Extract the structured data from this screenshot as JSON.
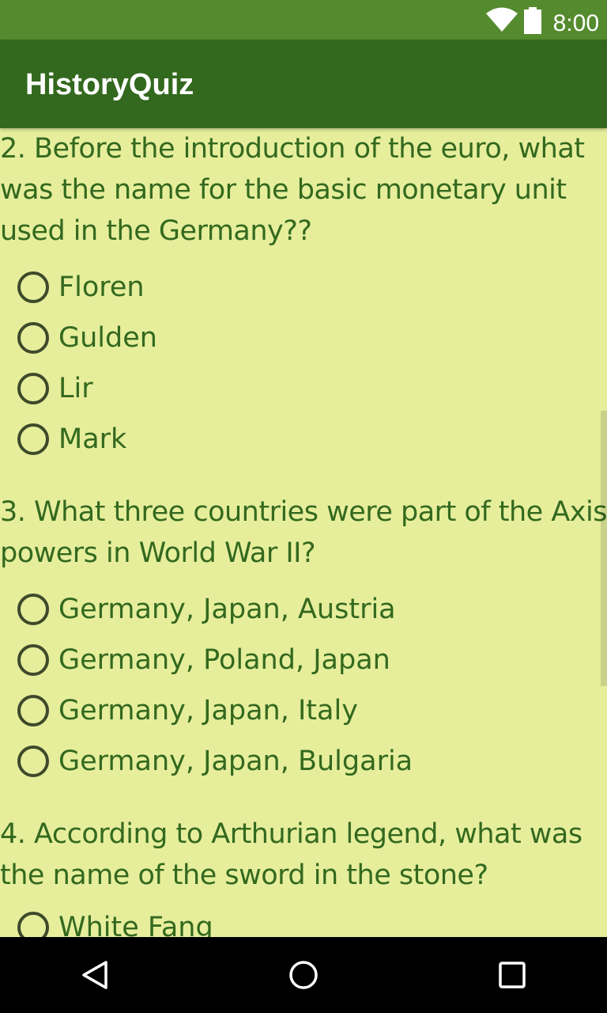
{
  "status_bar": {
    "time": "8:00",
    "icons": [
      "wifi-icon",
      "battery-icon"
    ]
  },
  "app_bar": {
    "title": "HistoryQuiz"
  },
  "questions": [
    {
      "text": "2. Before the introduction of the euro, what was the name for the basic monetary unit used in the Germany??",
      "options": [
        "Floren",
        "Gulden",
        "Lir",
        "Mark"
      ]
    },
    {
      "text": "3. What three countries were part of the Axis powers in World War II?",
      "options": [
        "Germany, Japan, Austria",
        "Germany, Poland, Japan",
        "Germany, Japan, Italy",
        "Germany, Japan, Bulgaria"
      ]
    },
    {
      "text": "4. According to Arthurian legend, what was the name of the sword in the stone?",
      "options": [
        "White Fang"
      ]
    }
  ],
  "nav_bar": {
    "icons": [
      "back-icon",
      "home-icon",
      "recents-icon"
    ]
  },
  "colors": {
    "status_bar": "#558b2f",
    "app_bar": "#33691e",
    "background": "#e6ee9c",
    "text": "#33691e"
  }
}
